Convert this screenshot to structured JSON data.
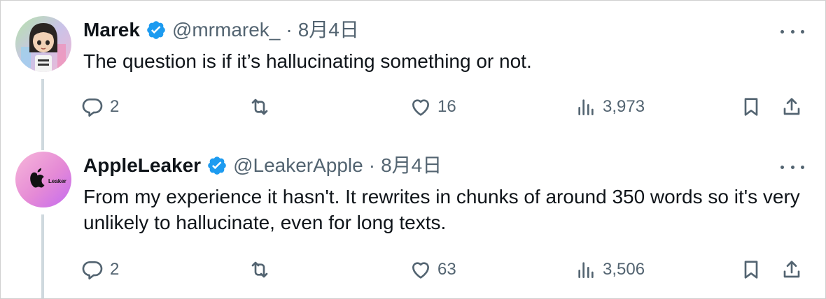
{
  "tweets": [
    {
      "name": "Marek",
      "handle": "@mrmarek_",
      "separator": "·",
      "date": "8月4日",
      "text": "The question is if it’s hallucinating something or not.",
      "replies": "2",
      "retweets": "",
      "likes": "16",
      "views": "3,973"
    },
    {
      "name": "AppleLeaker",
      "handle": "@LeakerApple",
      "separator": "·",
      "date": "8月4日",
      "text": "From my experience it hasn't. It rewrites in chunks of around 350 words so it's very unlikely to hallucinate, even for long texts.",
      "avatar_text": "Leaker",
      "replies": "2",
      "retweets": "",
      "likes": "63",
      "views": "3,506"
    }
  ],
  "colors": {
    "verified": "#1d9bf0",
    "muted": "#536471",
    "text": "#0f1419",
    "thread_line": "#cfd9de"
  },
  "icons": [
    "reply-icon",
    "retweet-icon",
    "like-icon",
    "views-icon",
    "bookmark-icon",
    "share-icon",
    "more-icon",
    "verified-badge-icon"
  ]
}
